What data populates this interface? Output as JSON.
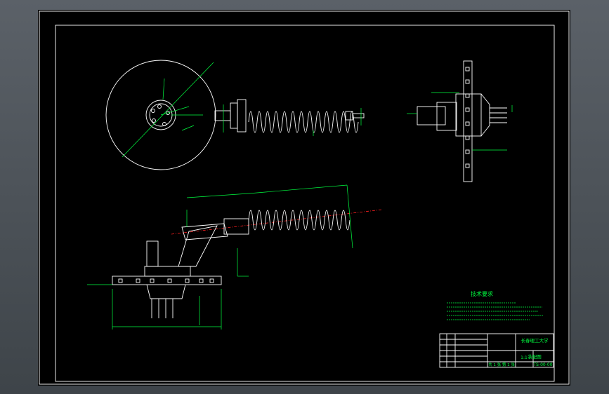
{
  "drawing": {
    "technical_requirements_title": "技术要求",
    "title_block": {
      "school": "长春理工大学",
      "drawing_name": "装配图",
      "drawing_number": "TS-00-00",
      "sheet_info": "共 1 张  第 1 张",
      "scale": "1:1"
    }
  },
  "colors": {
    "background": "#000000",
    "outline": "#ffffff",
    "dimension": "#00ff40",
    "centerline": "#ff2020",
    "viewport": "#4a5056"
  }
}
